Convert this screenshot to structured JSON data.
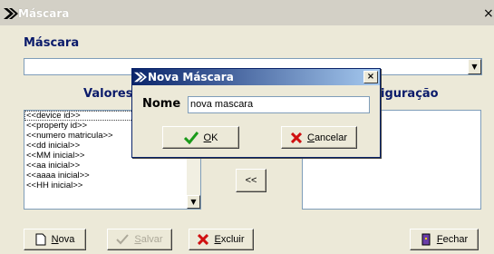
{
  "window": {
    "title": "Máscara",
    "close_glyph": "×"
  },
  "mascara_section": {
    "label": "Máscara",
    "combo_value": ""
  },
  "valores": {
    "label": "Valores",
    "items": [
      "<<device id>>",
      "<<property id>>",
      "<<numero matricula>>",
      "<<dd inicial>>",
      "<<MM inicial>>",
      "<<aa inicial>>",
      "<<aaaa inicial>>",
      "<<HH inicial>>"
    ]
  },
  "configuracao": {
    "label_visible": "iguração"
  },
  "move_button": {
    "label": "<<"
  },
  "bottom_buttons": {
    "nova": "Nova",
    "salvar": "Salvar",
    "excluir": "Excluir",
    "fechar": "Fechar"
  },
  "dialog": {
    "title": "Nova Máscara",
    "name_label": "Nome",
    "name_value": "nova mascara",
    "ok_label": "OK",
    "cancel_label": "Cancelar"
  },
  "colors": {
    "window_bg": "#ece9d8",
    "title_inactive": "#d3d0c6",
    "dialog_title_start": "#0a246a",
    "section_label": "#0a1a6a",
    "ok_icon": "#1a9a1a",
    "cancel_icon": "#d01010"
  },
  "icons": {
    "app": "arrow-logo-icon",
    "dropdown": "chevron-down-icon",
    "ok": "checkmark-icon",
    "cancel": "x-icon",
    "new": "document-icon",
    "save": "checkmark-icon",
    "delete": "x-icon",
    "close": "door-exit-icon"
  }
}
